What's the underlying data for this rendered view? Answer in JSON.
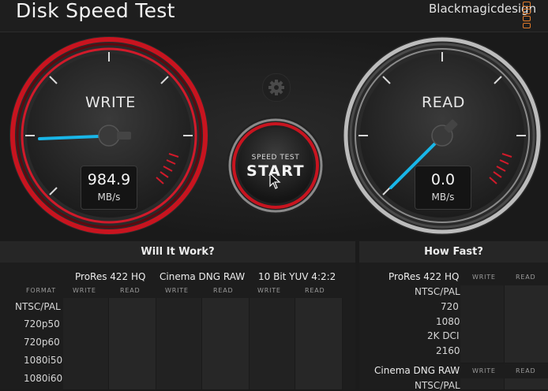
{
  "app": {
    "title": "Disk Speed Test",
    "brand": "Blackmagicdesign"
  },
  "gauges": {
    "write": {
      "label": "WRITE",
      "value": "984.9",
      "unit": "MB/s",
      "accent": "#d11a2a",
      "needle_color": "#19b6e8"
    },
    "read": {
      "label": "READ",
      "value": "0.0",
      "unit": "MB/s",
      "accent": "#9a9a9a",
      "needle_color": "#19b6e8"
    }
  },
  "start_button": {
    "sub_label": "SPEED TEST",
    "main_label": "START"
  },
  "settings": {
    "icon": "gear-icon"
  },
  "will_it_work": {
    "title": "Will It Work?",
    "format_header": "FORMAT",
    "write_label": "WRITE",
    "read_label": "READ",
    "codecs": [
      "ProRes 422 HQ",
      "Cinema DNG RAW",
      "10 Bit YUV 4:2:2"
    ],
    "formats": [
      "NTSC/PAL",
      "720p50",
      "720p60",
      "1080i50",
      "1080i60"
    ]
  },
  "how_fast": {
    "title": "How Fast?",
    "write_label": "WRITE",
    "read_label": "READ",
    "groups": [
      {
        "codec": "ProRes 422 HQ",
        "rows": [
          "NTSC/PAL",
          "720",
          "1080",
          "2K DCI",
          "2160"
        ]
      },
      {
        "codec": "Cinema DNG RAW",
        "rows": [
          "NTSC/PAL"
        ]
      }
    ]
  }
}
